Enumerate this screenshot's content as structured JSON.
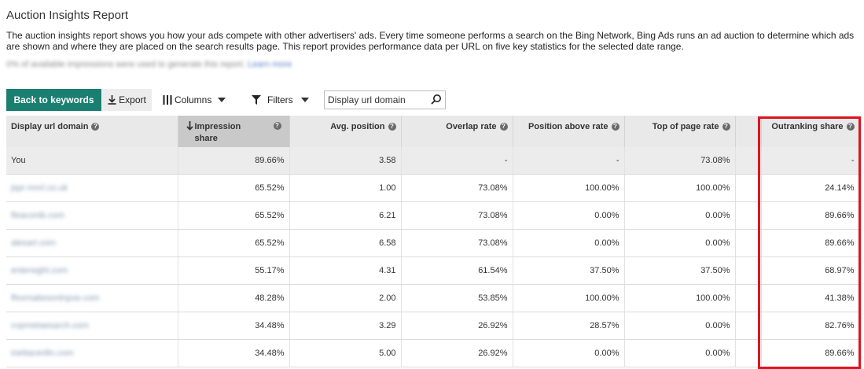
{
  "page": {
    "title": "Auction Insights Report",
    "description": "The auction insights report shows you how your ads compete with other advertisers' ads. Every time someone performs a search on the Bing Network, Bing Ads runs an ad auction to determine which ads are shown and where they are placed on the search results page. This report provides performance data per URL on five key statistics for the selected date range.",
    "note_blurred": "0% of available impressions were used to generate this report.",
    "note_link_blurred": "Learn more"
  },
  "toolbar": {
    "back_label": "Back to keywords",
    "export_label": "Export",
    "columns_label": "Columns",
    "filters_label": "Filters",
    "search_value": "Display url domain"
  },
  "table": {
    "columns": [
      {
        "label": "Display url domain"
      },
      {
        "label": "Impression share",
        "sorted": true
      },
      {
        "label": "Avg. position"
      },
      {
        "label": "Overlap rate"
      },
      {
        "label": "Position above rate"
      },
      {
        "label": "Top of page rate"
      },
      {
        "label": ""
      },
      {
        "label": "Outranking share"
      }
    ],
    "rows": [
      {
        "domain": "You",
        "impression_share": "89.66%",
        "avg_position": "3.58",
        "overlap_rate": "-",
        "position_above_rate": "-",
        "top_of_page_rate": "73.08%",
        "blank": "",
        "outranking_share": "-"
      },
      {
        "domain": "jspr-mnrl.co.uk",
        "impression_share": "65.52%",
        "avg_position": "1.00",
        "overlap_rate": "73.08%",
        "position_above_rate": "100.00%",
        "top_of_page_rate": "100.00%",
        "blank": "",
        "outranking_share": "24.14%"
      },
      {
        "domain": "fleaconib.com",
        "impression_share": "65.52%",
        "avg_position": "6.21",
        "overlap_rate": "73.08%",
        "position_above_rate": "0.00%",
        "top_of_page_rate": "0.00%",
        "blank": "",
        "outranking_share": "89.66%"
      },
      {
        "domain": "alesart.com",
        "impression_share": "65.52%",
        "avg_position": "6.58",
        "overlap_rate": "73.08%",
        "position_above_rate": "0.00%",
        "top_of_page_rate": "0.00%",
        "blank": "",
        "outranking_share": "89.66%"
      },
      {
        "domain": "enterwght.com",
        "impression_share": "55.17%",
        "avg_position": "4.31",
        "overlap_rate": "61.54%",
        "position_above_rate": "37.50%",
        "top_of_page_rate": "37.50%",
        "blank": "",
        "outranking_share": "68.97%"
      },
      {
        "domain": "ffoxmatiesonlnpxe.com",
        "impression_share": "48.28%",
        "avg_position": "2.00",
        "overlap_rate": "53.85%",
        "position_above_rate": "100.00%",
        "top_of_page_rate": "100.00%",
        "blank": "",
        "outranking_share": "41.38%"
      },
      {
        "domain": "cvprnetaesarch.com",
        "impression_share": "34.48%",
        "avg_position": "3.29",
        "overlap_rate": "26.92%",
        "position_above_rate": "28.57%",
        "top_of_page_rate": "0.00%",
        "blank": "",
        "outranking_share": "82.76%"
      },
      {
        "domain": "inettacerilin.com",
        "impression_share": "34.48%",
        "avg_position": "5.00",
        "overlap_rate": "26.92%",
        "position_above_rate": "0.00%",
        "top_of_page_rate": "0.00%",
        "blank": "",
        "outranking_share": "89.66%"
      }
    ]
  },
  "colors": {
    "primary_button": "#1a7f71",
    "highlight_box": "#e0141e",
    "sorted_header": "#c9c9c9"
  },
  "icons": [
    "download-icon",
    "columns-icon",
    "filter-icon",
    "search-icon",
    "help-icon",
    "sort-down-arrow-icon"
  ]
}
